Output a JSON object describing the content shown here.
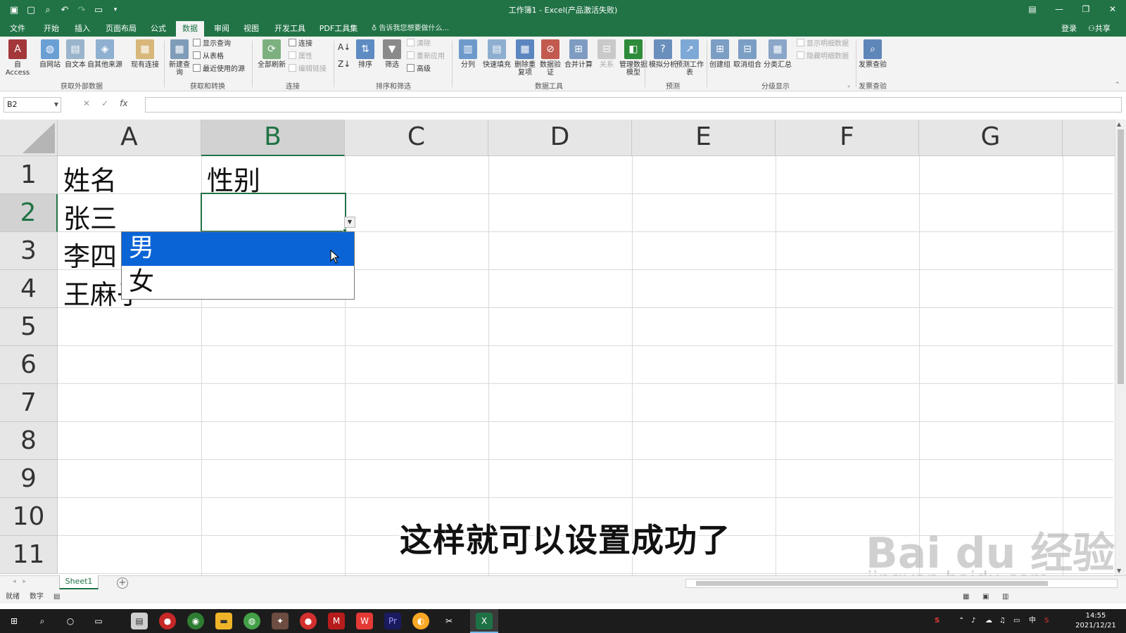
{
  "window": {
    "title": "工作簿1 - Excel(产品激活失败)",
    "controls": [
      "ribbon-display",
      "minimize",
      "restore",
      "close"
    ]
  },
  "quick_access": [
    "save-icon",
    "new-icon",
    "print-preview-icon",
    "undo-icon",
    "redo-icon",
    "open-icon",
    "customize-icon"
  ],
  "menu_tabs": [
    {
      "label": "文件"
    },
    {
      "label": "开始"
    },
    {
      "label": "插入"
    },
    {
      "label": "页面布局"
    },
    {
      "label": "公式"
    },
    {
      "label": "数据",
      "active": true
    },
    {
      "label": "审阅"
    },
    {
      "label": "视图"
    },
    {
      "label": "开发工具"
    },
    {
      "label": "PDF工具集"
    }
  ],
  "tell_me": "告诉我您想要做什么...",
  "account": {
    "login": "登录",
    "share": "共享"
  },
  "ribbon": {
    "external_data": {
      "label": "获取外部数据",
      "buttons": [
        "自 Access",
        "自网站",
        "自文本",
        "自其他来源",
        "现有连接"
      ]
    },
    "get_transform": {
      "label": "获取和转换",
      "new_query": "新建查询",
      "small": [
        "显示查询",
        "从表格",
        "最近使用的源"
      ]
    },
    "connections": {
      "label": "连接",
      "refresh_all": "全部刷新",
      "small": [
        "连接",
        "属性",
        "编辑链接"
      ]
    },
    "sort_filter": {
      "label": "排序和筛选",
      "sort": "排序",
      "filter": "筛选",
      "small": [
        "清除",
        "重新应用",
        "高级"
      ]
    },
    "data_tools": {
      "label": "数据工具",
      "buttons": [
        "分列",
        "快速填充",
        "删除重复项",
        "数据验证",
        "合并计算",
        "关系",
        "管理数据模型"
      ]
    },
    "forecast": {
      "label": "预测",
      "buttons": [
        "模拟分析",
        "预测工作表"
      ]
    },
    "outline": {
      "label": "分级显示",
      "buttons": [
        "创建组",
        "取消组合",
        "分类汇总"
      ],
      "small": [
        "显示明细数据",
        "隐藏明细数据"
      ]
    },
    "invoice": {
      "label": "发票查验",
      "button": "发票查验"
    }
  },
  "formula_bar": {
    "name_box": "B2",
    "cancel": "✕",
    "enter": "✓",
    "fx": "fx",
    "value": ""
  },
  "columns": [
    "A",
    "B",
    "C",
    "D",
    "E",
    "F",
    "G"
  ],
  "rows": [
    "1",
    "2",
    "3",
    "4",
    "5",
    "6",
    "7",
    "8",
    "9",
    "10",
    "11"
  ],
  "cells": {
    "A1": "姓名",
    "B1": "性别",
    "A2": "张三",
    "A3": "李四",
    "A4": "王麻子"
  },
  "active_cell": "B2",
  "validation_dropdown": {
    "options": [
      "男",
      "女"
    ],
    "highlighted": "男"
  },
  "subtitle": "这样就可以设置成功了",
  "watermark": {
    "brand": "Bai du 经验",
    "url": "jingyan.baidu.com"
  },
  "sheets": [
    {
      "name": "Sheet1",
      "active": true
    }
  ],
  "status": {
    "ready": "就绪",
    "mode": "数字"
  },
  "taskbar": {
    "apps": [
      "start-icon",
      "search-icon",
      "cortana-icon",
      "task-view-icon",
      "file-manager-icon",
      "record-icon",
      "chrome-icon",
      "folder-icon",
      "browser-icon",
      "photo-icon",
      "record2-icon",
      "mail-icon",
      "wps-icon",
      "premiere-icon",
      "media-icon",
      "capcut-icon",
      "excel-icon"
    ],
    "time": "14:55",
    "date": "2021/12/21",
    "ime": "中"
  }
}
